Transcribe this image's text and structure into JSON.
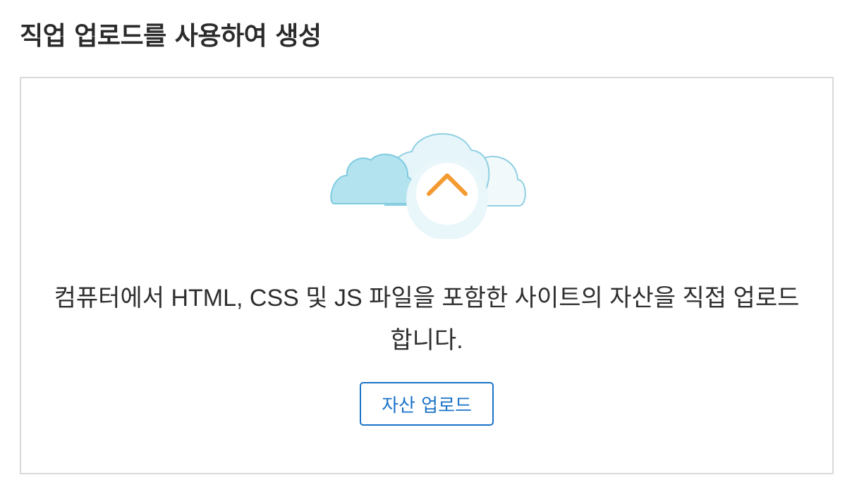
{
  "header": {
    "title": "직업 업로드를 사용하여 생성"
  },
  "upload_panel": {
    "icon": "cloud-upload-icon",
    "description": "컴퓨터에서 HTML, CSS 및 JS 파일을 포함한 사이트의 자산을 직접 업로드합니다.",
    "upload_button_label": "자산 업로드"
  },
  "colors": {
    "accent": "#1a73c8",
    "arrow": "#f28c28",
    "cloud_fill": "#b3e3ef",
    "cloud_stroke": "#7fcbe0",
    "border": "#d9d9d9"
  }
}
